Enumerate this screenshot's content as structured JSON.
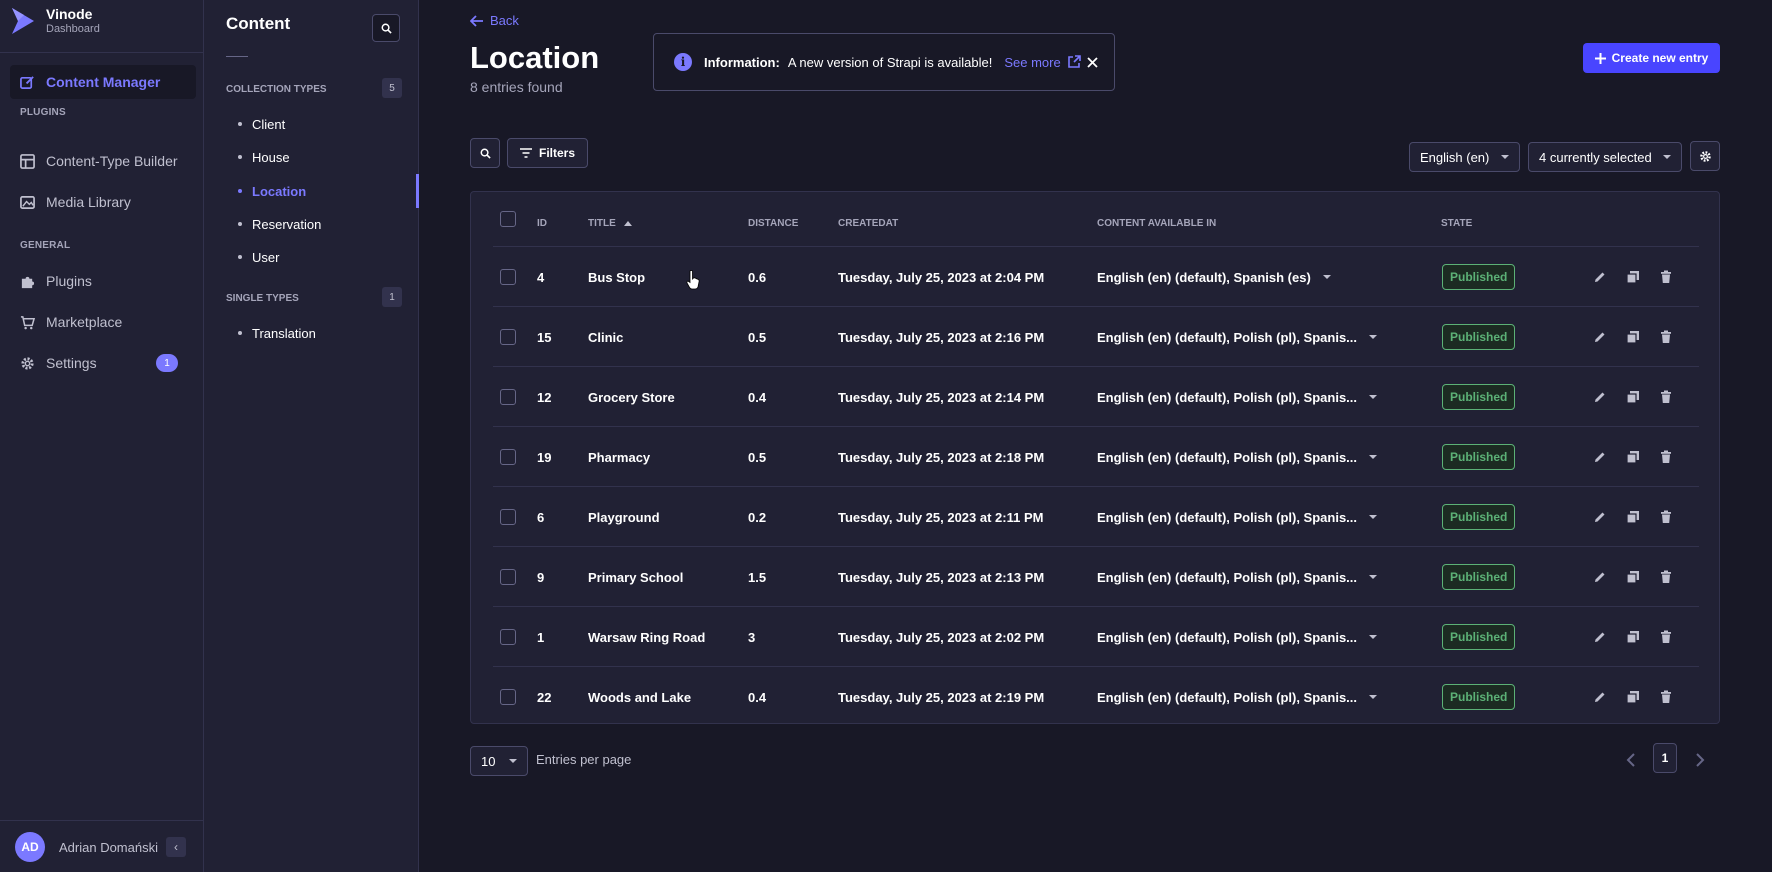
{
  "brand": {
    "name": "Vinode",
    "subtitle": "Dashboard"
  },
  "mainnav": {
    "content_manager": "Content Manager",
    "plugins_section": "PLUGINS",
    "content_type_builder": "Content-Type Builder",
    "media_library": "Media Library",
    "general_section": "GENERAL",
    "plugins": "Plugins",
    "marketplace": "Marketplace",
    "settings": "Settings",
    "settings_badge": "1",
    "user_initials": "AD",
    "user_name": "Adrian Domański"
  },
  "subnav": {
    "title": "Content",
    "collection_types_label": "COLLECTION TYPES",
    "collection_types_count": "5",
    "collection_types": [
      "Client",
      "House",
      "Location",
      "Reservation",
      "User"
    ],
    "single_types_label": "SINGLE TYPES",
    "single_types_count": "1",
    "single_types": [
      "Translation"
    ]
  },
  "header": {
    "back": "Back",
    "title": "Location",
    "subtitle": "8 entries found",
    "create_button": "Create new entry"
  },
  "notice": {
    "label": "Information:",
    "message": "A new version of Strapi is available!",
    "link": "See more"
  },
  "toolbar": {
    "filters": "Filters",
    "locale": "English (en)",
    "columns": "4 currently selected"
  },
  "table": {
    "headers": {
      "id": "ID",
      "title": "TITLE",
      "distance": "DISTANCE",
      "created": "CREATEDAT",
      "available": "CONTENT AVAILABLE IN",
      "state": "STATE"
    },
    "rows": [
      {
        "id": "4",
        "title": "Bus Stop",
        "distance": "0.6",
        "created": "Tuesday, July 25, 2023 at 2:04 PM",
        "available": "English (en) (default), Spanish (es)",
        "state": "Published"
      },
      {
        "id": "15",
        "title": "Clinic",
        "distance": "0.5",
        "created": "Tuesday, July 25, 2023 at 2:16 PM",
        "available": "English (en) (default), Polish (pl), Spanis...",
        "state": "Published"
      },
      {
        "id": "12",
        "title": "Grocery Store",
        "distance": "0.4",
        "created": "Tuesday, July 25, 2023 at 2:14 PM",
        "available": "English (en) (default), Polish (pl), Spanis...",
        "state": "Published"
      },
      {
        "id": "19",
        "title": "Pharmacy",
        "distance": "0.5",
        "created": "Tuesday, July 25, 2023 at 2:18 PM",
        "available": "English (en) (default), Polish (pl), Spanis...",
        "state": "Published"
      },
      {
        "id": "6",
        "title": "Playground",
        "distance": "0.2",
        "created": "Tuesday, July 25, 2023 at 2:11 PM",
        "available": "English (en) (default), Polish (pl), Spanis...",
        "state": "Published"
      },
      {
        "id": "9",
        "title": "Primary School",
        "distance": "1.5",
        "created": "Tuesday, July 25, 2023 at 2:13 PM",
        "available": "English (en) (default), Polish (pl), Spanis...",
        "state": "Published"
      },
      {
        "id": "1",
        "title": "Warsaw Ring Road",
        "distance": "3",
        "created": "Tuesday, July 25, 2023 at 2:02 PM",
        "available": "English (en) (default), Polish (pl), Spanis...",
        "state": "Published"
      },
      {
        "id": "22",
        "title": "Woods and Lake",
        "distance": "0.4",
        "created": "Tuesday, July 25, 2023 at 2:19 PM",
        "available": "English (en) (default), Polish (pl), Spanis...",
        "state": "Published"
      }
    ]
  },
  "footer": {
    "per_page": "10",
    "per_page_label": "Entries per page",
    "page": "1"
  },
  "colors": {
    "accent": "#7b79ff",
    "primary_button": "#4945ff",
    "published": "#5cb176",
    "background": "#181826",
    "panel": "#212134"
  }
}
